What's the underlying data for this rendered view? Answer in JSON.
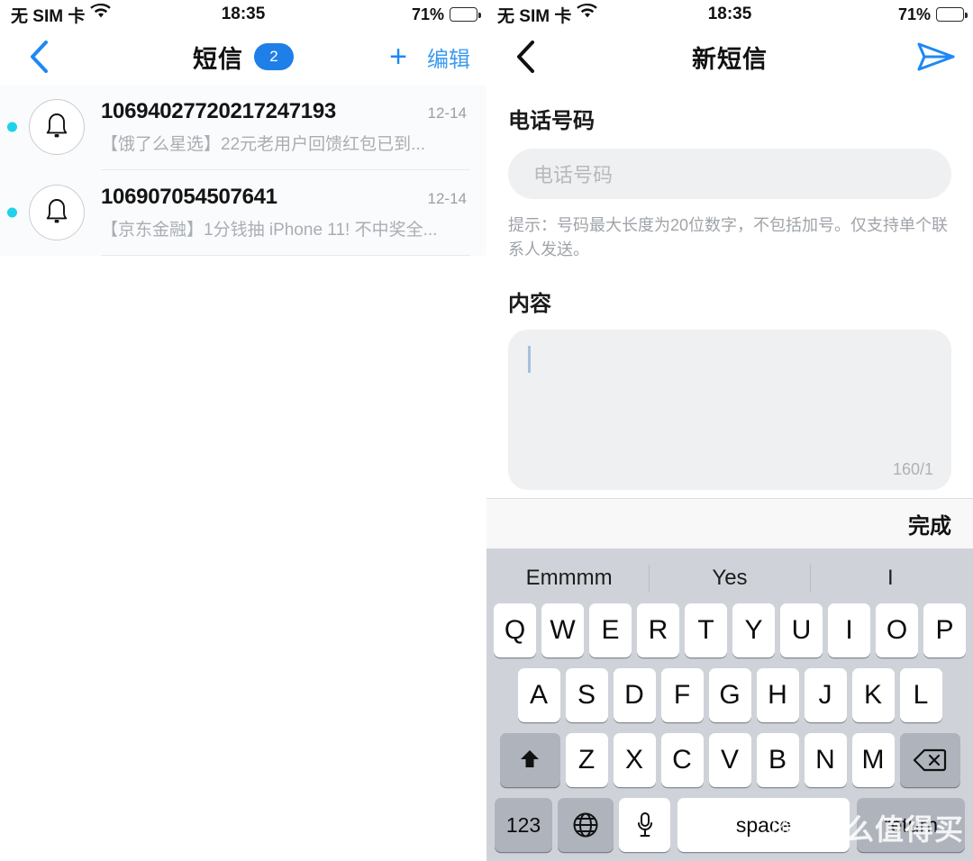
{
  "left_pane": {
    "status_bar": {
      "carrier": "无 SIM 卡",
      "wifi_icon": "wifi-icon",
      "time": "18:35",
      "battery_percent": "71%",
      "battery_level": 71
    },
    "nav": {
      "back_icon": "chevron-left-icon",
      "title": "短信",
      "badge_count": "2",
      "add_label": "+",
      "edit_label": "编辑"
    },
    "messages": [
      {
        "sender": "10694027720217247193",
        "date": "12-14",
        "preview": "【饿了么星选】22元老用户回馈红包已到...",
        "unread": true,
        "avatar_icon": "bell-icon"
      },
      {
        "sender": "106907054507641",
        "date": "12-14",
        "preview": "【京东金融】1分钱抽 iPhone 11! 不中奖全...",
        "unread": true,
        "avatar_icon": "bell-icon"
      }
    ]
  },
  "right_pane": {
    "status_bar": {
      "carrier": "无 SIM 卡",
      "wifi_icon": "wifi-icon",
      "time": "18:35",
      "battery_percent": "71%",
      "battery_level": 71
    },
    "nav": {
      "back_icon": "chevron-left-icon",
      "title": "新短信",
      "send_icon": "send-paper-plane-icon"
    },
    "form": {
      "phone_label": "电话号码",
      "phone_value": "",
      "phone_placeholder": "电话号码",
      "hint": "提示：号码最大长度为20位数字，不包括加号。仅支持单个联系人发送。",
      "content_label": "内容",
      "content_value": "",
      "counter": "160/1"
    },
    "keyboard": {
      "done_label": "完成",
      "suggestions": [
        "Emmmm",
        "Yes",
        "I"
      ],
      "row1": [
        "Q",
        "W",
        "E",
        "R",
        "T",
        "Y",
        "U",
        "I",
        "O",
        "P"
      ],
      "row2": [
        "A",
        "S",
        "D",
        "F",
        "G",
        "H",
        "J",
        "K",
        "L"
      ],
      "row3": [
        "Z",
        "X",
        "C",
        "V",
        "B",
        "N",
        "M"
      ],
      "shift_icon": "shift-up-arrow-icon",
      "backspace_icon": "backspace-delete-icon",
      "numbers_label": "123",
      "globe_icon": "globe-language-icon",
      "mic_icon": "microphone-icon",
      "space_label": "space",
      "return_label": "return"
    }
  },
  "watermark": {
    "mark_char": "值",
    "text": "什么值得买"
  },
  "colors": {
    "accent_blue": "#1E7FE8",
    "link_blue": "#3C9BF0",
    "unread_cyan": "#1FD2E8",
    "keyboard_bg": "#CFD3D9",
    "key_dark": "#AEB3BC",
    "field_gray": "#EFF0F1"
  }
}
